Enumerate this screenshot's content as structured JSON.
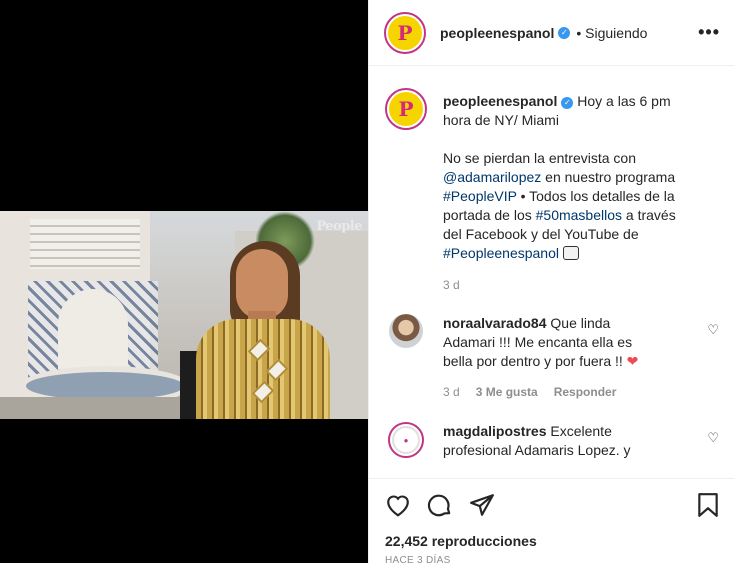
{
  "post": {
    "author": "peopleenespanol",
    "follow_status": "Siguiendo",
    "avatar_text": "P",
    "caption": {
      "line1": "Hoy a las 6 pm",
      "line2": "hora de NY/ Miami",
      "p2_a": "No se pierdan la entrevista con",
      "mention": "@adamarilopez",
      "p2_b": " en nuestro programa",
      "hashtag1": "#PeopleVIP",
      "p2_c": " • Todos los detalles de la",
      "p2_d": "portada de los ",
      "hashtag2": "#50masbellos",
      "p2_e": " a través",
      "p2_f": "del Facebook y del YouTube de",
      "hashtag3": "#Peopleenespanol",
      "age": "3 d"
    },
    "media_watermark": "People"
  },
  "comments": [
    {
      "user": "noraalvarado84",
      "text1": "Que linda",
      "text2": "Adamari !!! Me encanta ella es",
      "text3": "bella por dentro y por fuera !!",
      "age": "3 d",
      "likes": "3 Me gusta",
      "reply": "Responder"
    },
    {
      "user": "magdalipostres",
      "text1": "Excelente",
      "text2": "profesional Adamaris Lopez. y"
    }
  ],
  "stats": {
    "views": "22,452 reproducciones",
    "timestamp": "HACE 3 DÍAS"
  },
  "colors": {
    "accent_link": "#00376b",
    "verified": "#3897f0",
    "heart": "#ed4956"
  },
  "icons": [
    "verified-icon",
    "more-icon",
    "heart-icon",
    "comment-icon",
    "share-icon",
    "save-icon",
    "tv-icon"
  ]
}
